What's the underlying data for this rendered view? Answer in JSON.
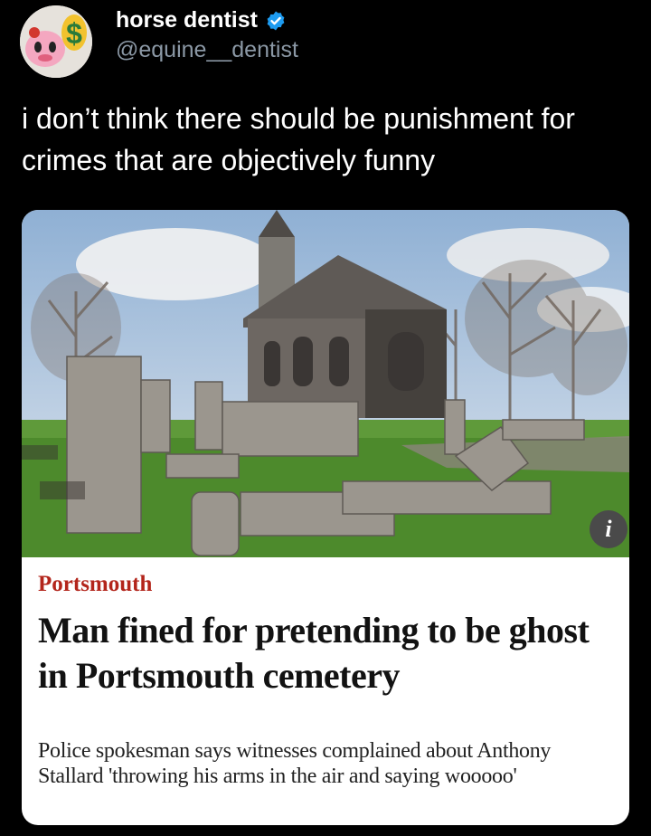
{
  "tweet": {
    "author_name": "horse dentist",
    "author_handle": "@equine__dentist",
    "verified": true,
    "text": "i don’t think there should be punishment for crimes that are objectively funny"
  },
  "card": {
    "section": "Portsmouth",
    "headline": "Man fined for pretending to be ghost in Portsmouth cemetery",
    "standfirst": "Police spokesman says witnesses complained about Anthony Stallard 'throwing his arms in the air and saying wooooo'",
    "info_icon": "info-icon"
  },
  "colors": {
    "background": "#000000",
    "handle": "#8b98a5",
    "verified_badge": "#1d9bf0",
    "section_label": "#b3251b"
  }
}
